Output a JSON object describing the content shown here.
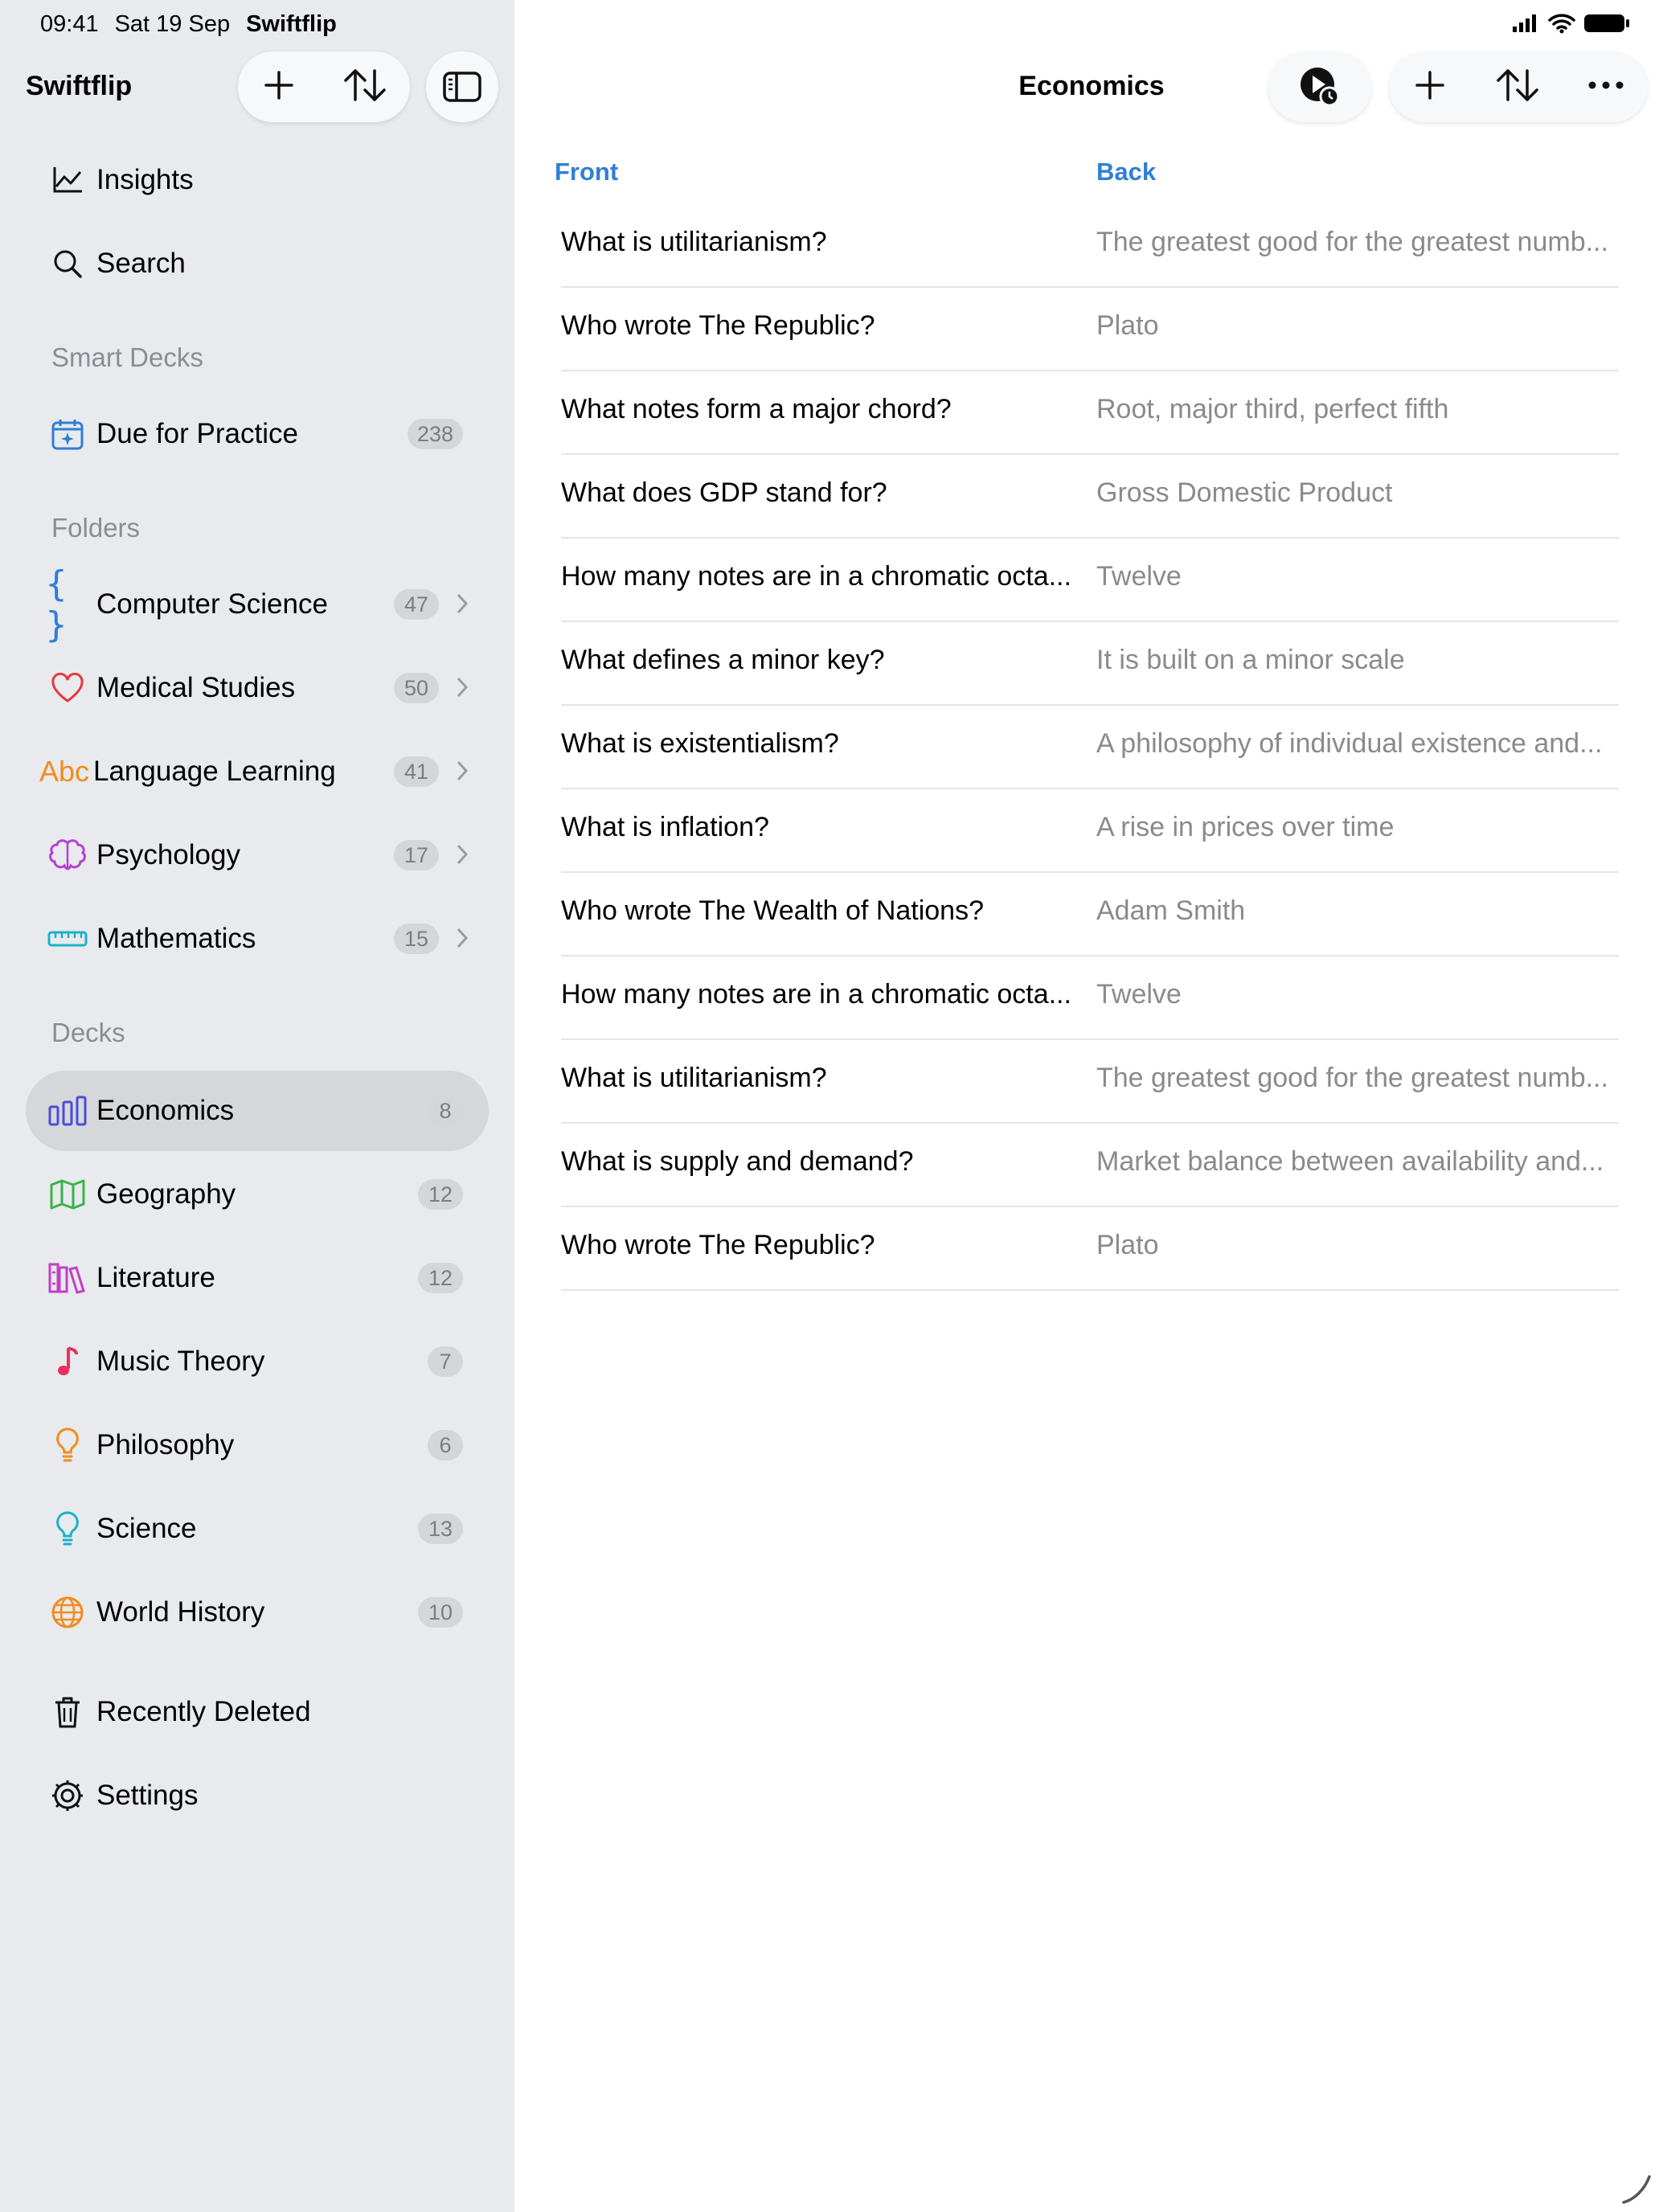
{
  "status": {
    "time": "09:41",
    "date": "Sat 19 Sep",
    "app": "Swiftflip"
  },
  "sidebar": {
    "title": "Swiftflip",
    "top_items": [
      {
        "label": "Insights",
        "icon": "chart-line-icon"
      },
      {
        "label": "Search",
        "icon": "search-icon"
      }
    ],
    "smart_decks_header": "Smart Decks",
    "smart_decks": [
      {
        "label": "Due for Practice",
        "count": "238",
        "icon": "calendar-sparkle-icon",
        "color": "#2f7fd6"
      }
    ],
    "folders_header": "Folders",
    "folders": [
      {
        "label": "Computer Science",
        "count": "47",
        "icon": "curly-braces-icon",
        "color": "#2f7fd6"
      },
      {
        "label": "Medical Studies",
        "count": "50",
        "icon": "heart-icon",
        "color": "#e5393f"
      },
      {
        "label": "Language Learning",
        "count": "41",
        "icon": "abc-icon",
        "color": "#f08c1e"
      },
      {
        "label": "Psychology",
        "count": "17",
        "icon": "brain-icon",
        "color": "#b43fd6"
      },
      {
        "label": "Mathematics",
        "count": "15",
        "icon": "ruler-icon",
        "color": "#1bb1c9"
      }
    ],
    "decks_header": "Decks",
    "decks": [
      {
        "label": "Economics",
        "count": "8",
        "icon": "bar-chart-icon",
        "color": "#4b4bd6",
        "selected": true
      },
      {
        "label": "Geography",
        "count": "12",
        "icon": "map-icon",
        "color": "#3ab34a"
      },
      {
        "label": "Literature",
        "count": "12",
        "icon": "books-icon",
        "color": "#c23fc8"
      },
      {
        "label": "Music Theory",
        "count": "7",
        "icon": "music-note-icon",
        "color": "#e8315b"
      },
      {
        "label": "Philosophy",
        "count": "6",
        "icon": "lightbulb-icon",
        "color": "#f08c1e"
      },
      {
        "label": "Science",
        "count": "13",
        "icon": "lightbulb-icon",
        "color": "#1bb1c9"
      },
      {
        "label": "World History",
        "count": "10",
        "icon": "globe-icon",
        "color": "#f08c1e"
      }
    ],
    "bottom_items": [
      {
        "label": "Recently Deleted",
        "icon": "trash-icon"
      },
      {
        "label": "Settings",
        "icon": "gear-icon"
      }
    ]
  },
  "main": {
    "title": "Economics",
    "front_header": "Front",
    "back_header": "Back",
    "cards": [
      {
        "front": "What is utilitarianism?",
        "back": "The greatest good for the greatest numb..."
      },
      {
        "front": "Who wrote The Republic?",
        "back": "Plato"
      },
      {
        "front": "What notes form a major chord?",
        "back": "Root, major third, perfect fifth"
      },
      {
        "front": "What does GDP stand for?",
        "back": "Gross Domestic Product"
      },
      {
        "front": "How many notes are in a chromatic octa...",
        "back": "Twelve"
      },
      {
        "front": "What defines a minor key?",
        "back": "It is built on a minor scale"
      },
      {
        "front": "What is existentialism?",
        "back": "A philosophy of individual existence and..."
      },
      {
        "front": "What is inflation?",
        "back": "A rise in prices over time"
      },
      {
        "front": "Who wrote The Wealth of Nations?",
        "back": "Adam Smith"
      },
      {
        "front": "How many notes are in a chromatic octa...",
        "back": "Twelve"
      },
      {
        "front": "What is utilitarianism?",
        "back": "The greatest good for the greatest numb..."
      },
      {
        "front": "What is supply and demand?",
        "back": "Market balance between availability and..."
      },
      {
        "front": "Who wrote The Republic?",
        "back": "Plato"
      }
    ]
  }
}
